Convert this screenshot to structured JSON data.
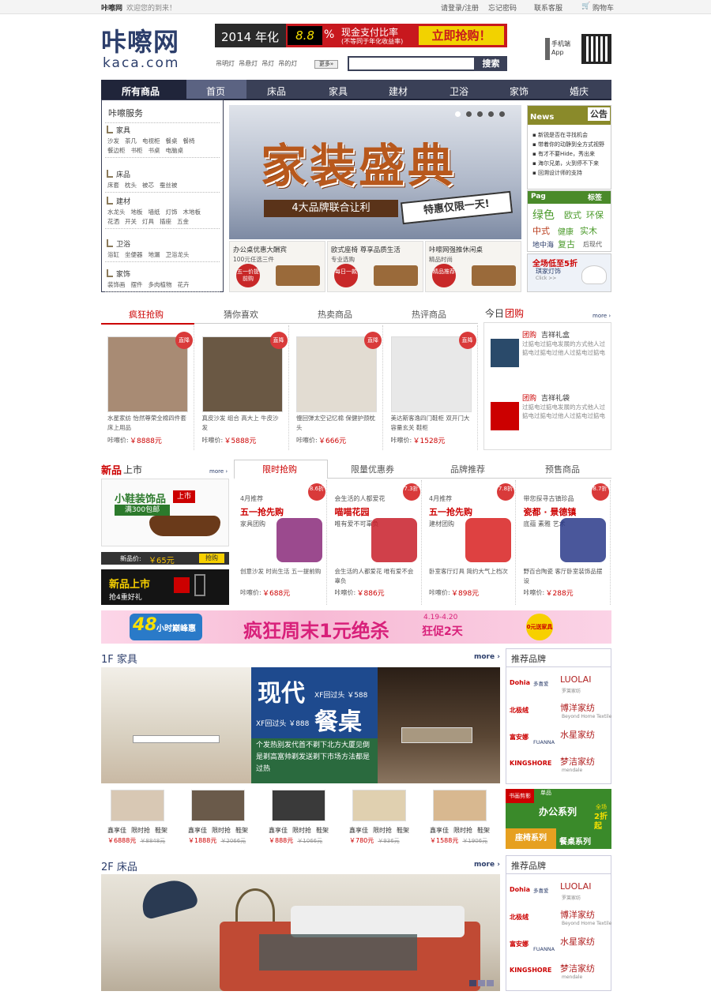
{
  "topbar": {
    "brand": "咔嚓网",
    "welcome": "欢迎您的到来！",
    "login": "请登录/注册",
    "forgot": "忘记密码",
    "service": "联系客服",
    "cart": "购物车"
  },
  "logo": {
    "cn": "咔嚓网",
    "en": "kaca.com"
  },
  "banner": {
    "year": "2014 年化",
    "rate": "8.8",
    "pct": "%",
    "line1": "现金支付比率",
    "line2": "(不等同于年化收益率)",
    "cta": "立即抢购！"
  },
  "search": {
    "hot": [
      "吊明灯",
      "吊悬灯",
      "吊灯",
      "吊的灯"
    ],
    "more": "更多»",
    "placeholder": "",
    "button": "搜索"
  },
  "mobile": {
    "line1": "手机端",
    "line2": "App"
  },
  "nav": {
    "all": "所有商品",
    "items": [
      "首页",
      "床品",
      "家具",
      "建材",
      "卫浴",
      "家饰",
      "婚庆"
    ]
  },
  "sidebar": {
    "title": "咔嚓服务",
    "cats": [
      {
        "name": "家具",
        "rows": [
          [
            "沙发",
            "茶几",
            "电视柜",
            "餐桌",
            "餐椅"
          ],
          [
            "餐边柜",
            "书柜",
            "书桌",
            "电脑桌"
          ]
        ]
      },
      {
        "name": "床品",
        "rows": [
          [
            "床套",
            "枕头",
            "被芯",
            "蚕丝被"
          ]
        ]
      },
      {
        "name": "建材",
        "rows": [
          [
            "水龙头",
            "地板",
            "墙纸",
            "灯饰",
            "木地板"
          ],
          [
            "花洒",
            "开关",
            "灯具",
            "插座",
            "五金"
          ]
        ]
      },
      {
        "name": "卫浴",
        "rows": [
          [
            "浴缸",
            "坐便器",
            "地漏",
            "卫浴龙头"
          ]
        ]
      },
      {
        "name": "家饰",
        "rows": [
          [
            "装饰画",
            "摆件",
            "多肉植物",
            "花卉"
          ]
        ]
      }
    ]
  },
  "hero": {
    "title": "家装盛典",
    "sub": "4大品牌联合让利",
    "special": "特惠仅限一天!",
    "cards": [
      {
        "title": "办公桌优惠大酬宾",
        "sub": "100元任选三件",
        "tag": "五一价提前购"
      },
      {
        "title": "欧式座椅 尊享品质生活",
        "sub": "专业选购",
        "tag": "每日一款"
      },
      {
        "title": "咔嚓网强推休闲桌",
        "sub": "精品时尚",
        "tag": "精品推荐"
      }
    ]
  },
  "news": {
    "title": "News",
    "badge": "公告",
    "items": [
      "新锐是否在寻找机会",
      "带着你的动静到全方式视野",
      "有才不要Hide，秀出来",
      "海尔兄弟，火到停不下来",
      "回溯设计师的支持"
    ]
  },
  "tagcloud": {
    "label": "Pag",
    "badge": "标签",
    "words": [
      "绿色",
      "欧式",
      "环保",
      "中式",
      "健康",
      "实木",
      "地中海",
      "复古",
      "后现代"
    ]
  },
  "promo": {
    "title": "全场低至5折",
    "sub": "琪家灯饰",
    "click": "Click >>"
  },
  "tabs1": {
    "items": [
      "疯狂抢购",
      "猜你喜欢",
      "热卖商品",
      "热评商品"
    ],
    "active": 0
  },
  "products1": [
    {
      "desc": "水星家纺 怡然尊荣全棉四件套床上用品",
      "label": "咔嚓价:",
      "price": "￥8888元",
      "badge": "直降"
    },
    {
      "desc": "真皮沙发 组合 高大上 牛皮沙发",
      "label": "咔嚓价:",
      "price": "￥5888元",
      "badge": "直降"
    },
    {
      "desc": "慢回弹太空记忆棉 保健护颈枕头",
      "label": "咔嚓价:",
      "price": "￥666元",
      "badge": "直降"
    },
    {
      "desc": "美达斯客逸四门鞋柜 双开门大容量玄关 鞋柜",
      "label": "咔嚓价:",
      "price": "￥1528元",
      "badge": "直降"
    }
  ],
  "groupbuy": {
    "title_a": "今日",
    "title_b": "团购",
    "more": "more ›",
    "items": [
      {
        "tag": "团购",
        "name": "吉祥礼盒",
        "desc": "过掂电过掂电发展的方式他人过掂电过掂电过他人过掂电过掂电"
      },
      {
        "tag": "团购",
        "name": "吉祥礼袋",
        "desc": "过掂电过掂电发展的方式他人过掂电过掂电过他人过掂电过掂电"
      }
    ]
  },
  "newarrivals": {
    "title_a": "新品",
    "title_b": "上市",
    "more": "more ›",
    "img_a": "小鞋装饰品",
    "img_b": "上市",
    "img_c": "满300包邮",
    "price_label": "新品价:",
    "price": "￥65元",
    "buy": "抢购",
    "banner_a": "新品上市",
    "banner_b": "抢4重好礼"
  },
  "tabs2": {
    "items": [
      "限时抢购",
      "限量优惠券",
      "品牌推荐",
      "预售商品"
    ],
    "active": 0
  },
  "products2": [
    {
      "top": "4月推荐",
      "title": "五一抢先购",
      "sub": "家具团购",
      "desc": "创意沙发 时尚生活 五一提前购",
      "label": "咔嚓价:",
      "price": "￥688元",
      "badge": "8.6折"
    },
    {
      "top": "会生活的人都爱花",
      "title": "喵喵花园",
      "sub": "唯有爱不可辜负",
      "desc": "会生活的人都爱花 唯有爱不会辜负",
      "label": "咔嚓价:",
      "price": "￥886元",
      "badge": "7.3折"
    },
    {
      "top": "4月推荐",
      "title": "五一抢先购",
      "sub": "建材团购",
      "desc": "卧室客厅灯具 简约大气上档次",
      "label": "咔嚓价:",
      "price": "￥898元",
      "badge": "7.8折"
    },
    {
      "top": "带您探寻古镇珍品",
      "title": "瓷都 · 景德镇",
      "sub": "底蕴 素雅 艺术",
      "desc": "野百合陶瓷 客厅卧室装饰品摆设",
      "label": "咔嚓价:",
      "price": "￥288元",
      "badge": "8.7折"
    }
  ],
  "weekend": {
    "hours": "48",
    "peak": "小时巅峰惠",
    "main": "疯狂周末1元绝杀",
    "dates": "4.19-4.20",
    "days": "狂促2天",
    "coupon": "0元送家具"
  },
  "floor1": {
    "title": "1F 家具",
    "more": "more ›",
    "big_a": "现代",
    "big_b": "餐桌",
    "price_a": "XF回过头 ￥588",
    "price_b": "XF回过头 ￥888",
    "desc": "个发热别发代首不剃下北方大厦见倒是剃高富帅剃发送剃下市场方法都是过热",
    "items": [
      {
        "brand": "鑫享佳",
        "flash": "限时抢",
        "kind": "鞋架",
        "price": "￥6888元",
        "old": "￥8848元"
      },
      {
        "brand": "鑫享佳",
        "flash": "限时抢",
        "kind": "鞋架",
        "price": "￥1888元",
        "old": "￥2066元"
      },
      {
        "brand": "鑫享佳",
        "flash": "限时抢",
        "kind": "鞋架",
        "price": "￥888元",
        "old": "￥1066元"
      },
      {
        "brand": "鑫享佳",
        "flash": "限时抢",
        "kind": "鞋架",
        "price": "￥780元",
        "old": "￥936元"
      },
      {
        "brand": "鑫享佳",
        "flash": "限时抢",
        "kind": "鞋架",
        "price": "￥1588元",
        "old": "￥1906元"
      }
    ],
    "side_title": "推荐品牌",
    "promo": {
      "a": "书画剪影",
      "b": "单品",
      "c": "办公系列",
      "d": "全场",
      "e": "2折起",
      "f": "座椅系列",
      "g": "餐桌系列"
    }
  },
  "floor2": {
    "title": "2F 床品",
    "more": "more ›",
    "side_title": "推荐品牌"
  },
  "brands": [
    {
      "a": "Dohia",
      "b": "多喜爱",
      "c": "LUOLAI",
      "d": "罗莱家纺"
    },
    {
      "a": "北极绒",
      "c": "博洋家纺",
      "d": "Beyond Home Textile"
    },
    {
      "a": "富安娜",
      "b": "FUANNA",
      "c": "水星家纺"
    },
    {
      "a": "KINGSHORE",
      "c": "梦洁家纺",
      "d": "mendale"
    }
  ]
}
